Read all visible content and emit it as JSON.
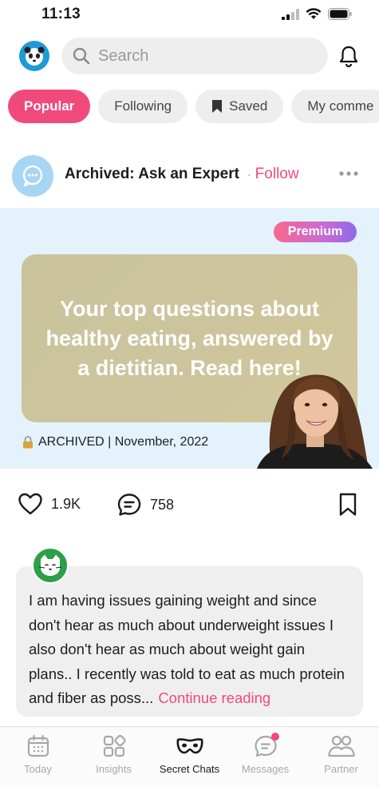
{
  "status_bar": {
    "time": "11:13"
  },
  "header": {
    "search_placeholder": "Search"
  },
  "tabs": [
    {
      "label": "Popular",
      "active": true
    },
    {
      "label": "Following",
      "active": false
    },
    {
      "label": "Saved",
      "active": false
    },
    {
      "label": "My comme",
      "active": false
    }
  ],
  "post": {
    "title": "Archived: Ask an Expert",
    "follow_label": "Follow",
    "badge": "Premium",
    "hero_text": "Your top questions about healthy eating, answered by a dietitian. Read here!",
    "caption": "ARCHIVED | November, 2022",
    "likes": "1.9K",
    "comments": "758"
  },
  "comment": {
    "text": "I am having issues gaining weight and since don't hear as much about underweight issues I also don't hear as much about weight gain plans.. I recently was told to eat as much protein and fiber as poss...",
    "continue_label": "Continue reading"
  },
  "bottom_nav": [
    {
      "label": "Today",
      "icon": "calendar-icon"
    },
    {
      "label": "Insights",
      "icon": "grid-icon"
    },
    {
      "label": "Secret Chats",
      "icon": "mask-icon",
      "active": true
    },
    {
      "label": "Messages",
      "icon": "chat-icon",
      "badge": true
    },
    {
      "label": "Partner",
      "icon": "partner-icon"
    }
  ],
  "colors": {
    "accent": "#f04a7d",
    "avatar_blue": "#1e9ad6",
    "comment_avatar": "#2d9f47"
  }
}
